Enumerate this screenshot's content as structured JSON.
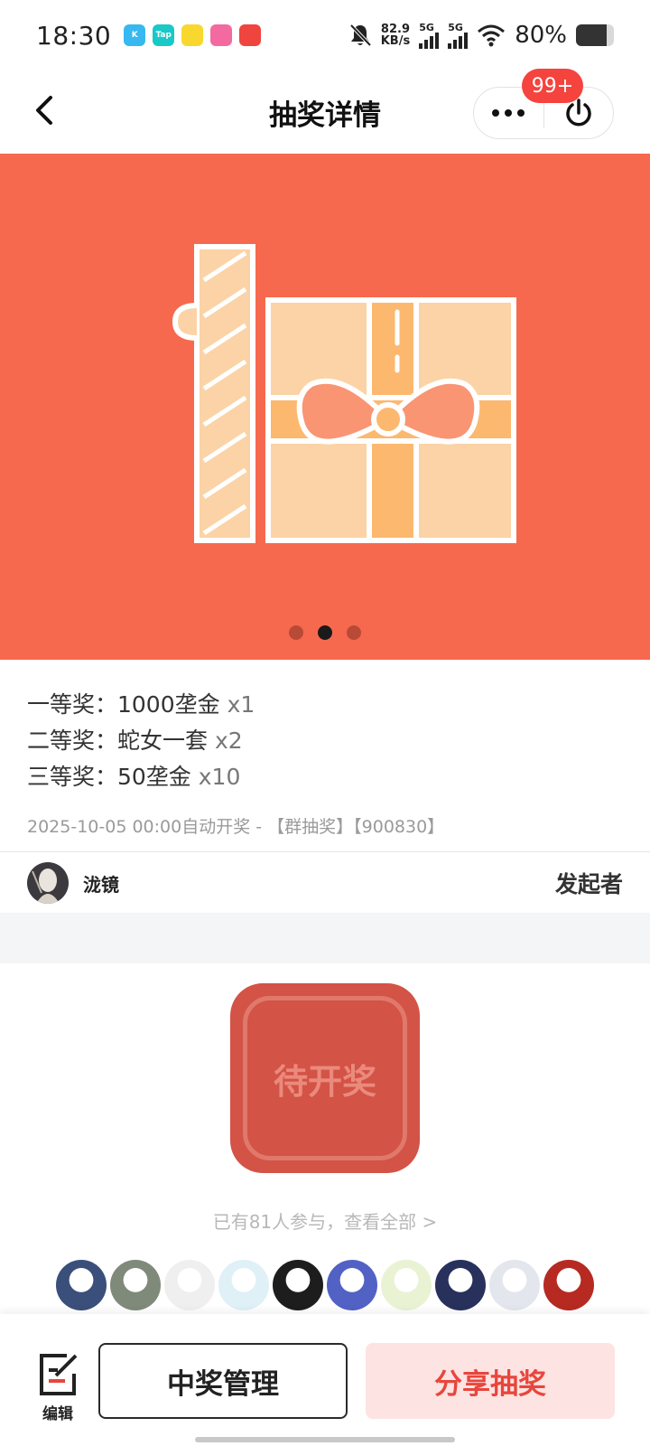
{
  "status_bar": {
    "time": "18:30",
    "app_icons": [
      {
        "name": "kuaishou-app-icon",
        "label": "K",
        "color": "#37b8f0"
      },
      {
        "name": "taptap-app-icon",
        "label": "Tap",
        "color": "#19c8c8"
      },
      {
        "name": "app-yellow-icon",
        "label": "",
        "color": "#f8d82e"
      },
      {
        "name": "app-pink-icon",
        "label": "",
        "color": "#f36aa0"
      },
      {
        "name": "app-red-icon",
        "label": "",
        "color": "#f0443e"
      }
    ],
    "net_speed_value": "82.9",
    "net_speed_unit": "KB/s",
    "signal_label_1": "5G",
    "signal_label_2": "5G",
    "battery_percent": "80%",
    "battery_level": 0.8
  },
  "nav": {
    "title": "抽奖详情",
    "badge": "99+"
  },
  "banner": {
    "background": "#f6694e",
    "slide_count": 3,
    "active_slide": 1
  },
  "prizes": [
    {
      "label": "一等奖：1000垄金",
      "qty": "x1"
    },
    {
      "label": "二等奖：蛇女一套",
      "qty": "x2"
    },
    {
      "label": "三等奖：50垄金",
      "qty": "x10"
    }
  ],
  "meta_text": "2025-10-05 00:00自动开奖 - 【群抽奖】【900830】",
  "initiator": {
    "name": "泷镜",
    "role": "发起者"
  },
  "draw_button": {
    "label": "待开奖"
  },
  "participants_text": "已有81人参与，查看全部 >",
  "participant_avatars": [
    {
      "name": "participant-avatar-1",
      "color": "#3a4f7a"
    },
    {
      "name": "participant-avatar-2",
      "color": "#7f8a7a"
    },
    {
      "name": "participant-avatar-3",
      "color": "#efefef"
    },
    {
      "name": "participant-avatar-4",
      "color": "#dff0f7"
    },
    {
      "name": "participant-avatar-5",
      "color": "#1d1d1d"
    },
    {
      "name": "participant-avatar-6",
      "color": "#5261c4"
    },
    {
      "name": "participant-avatar-7",
      "color": "#e9f3d4"
    },
    {
      "name": "participant-avatar-8",
      "color": "#27315c"
    },
    {
      "name": "participant-avatar-9",
      "color": "#e4e6ee"
    },
    {
      "name": "participant-avatar-10",
      "color": "#b62a22"
    }
  ],
  "bottom_bar": {
    "edit_label": "编辑",
    "manage_label": "中奖管理",
    "share_label": "分享抽奖"
  }
}
